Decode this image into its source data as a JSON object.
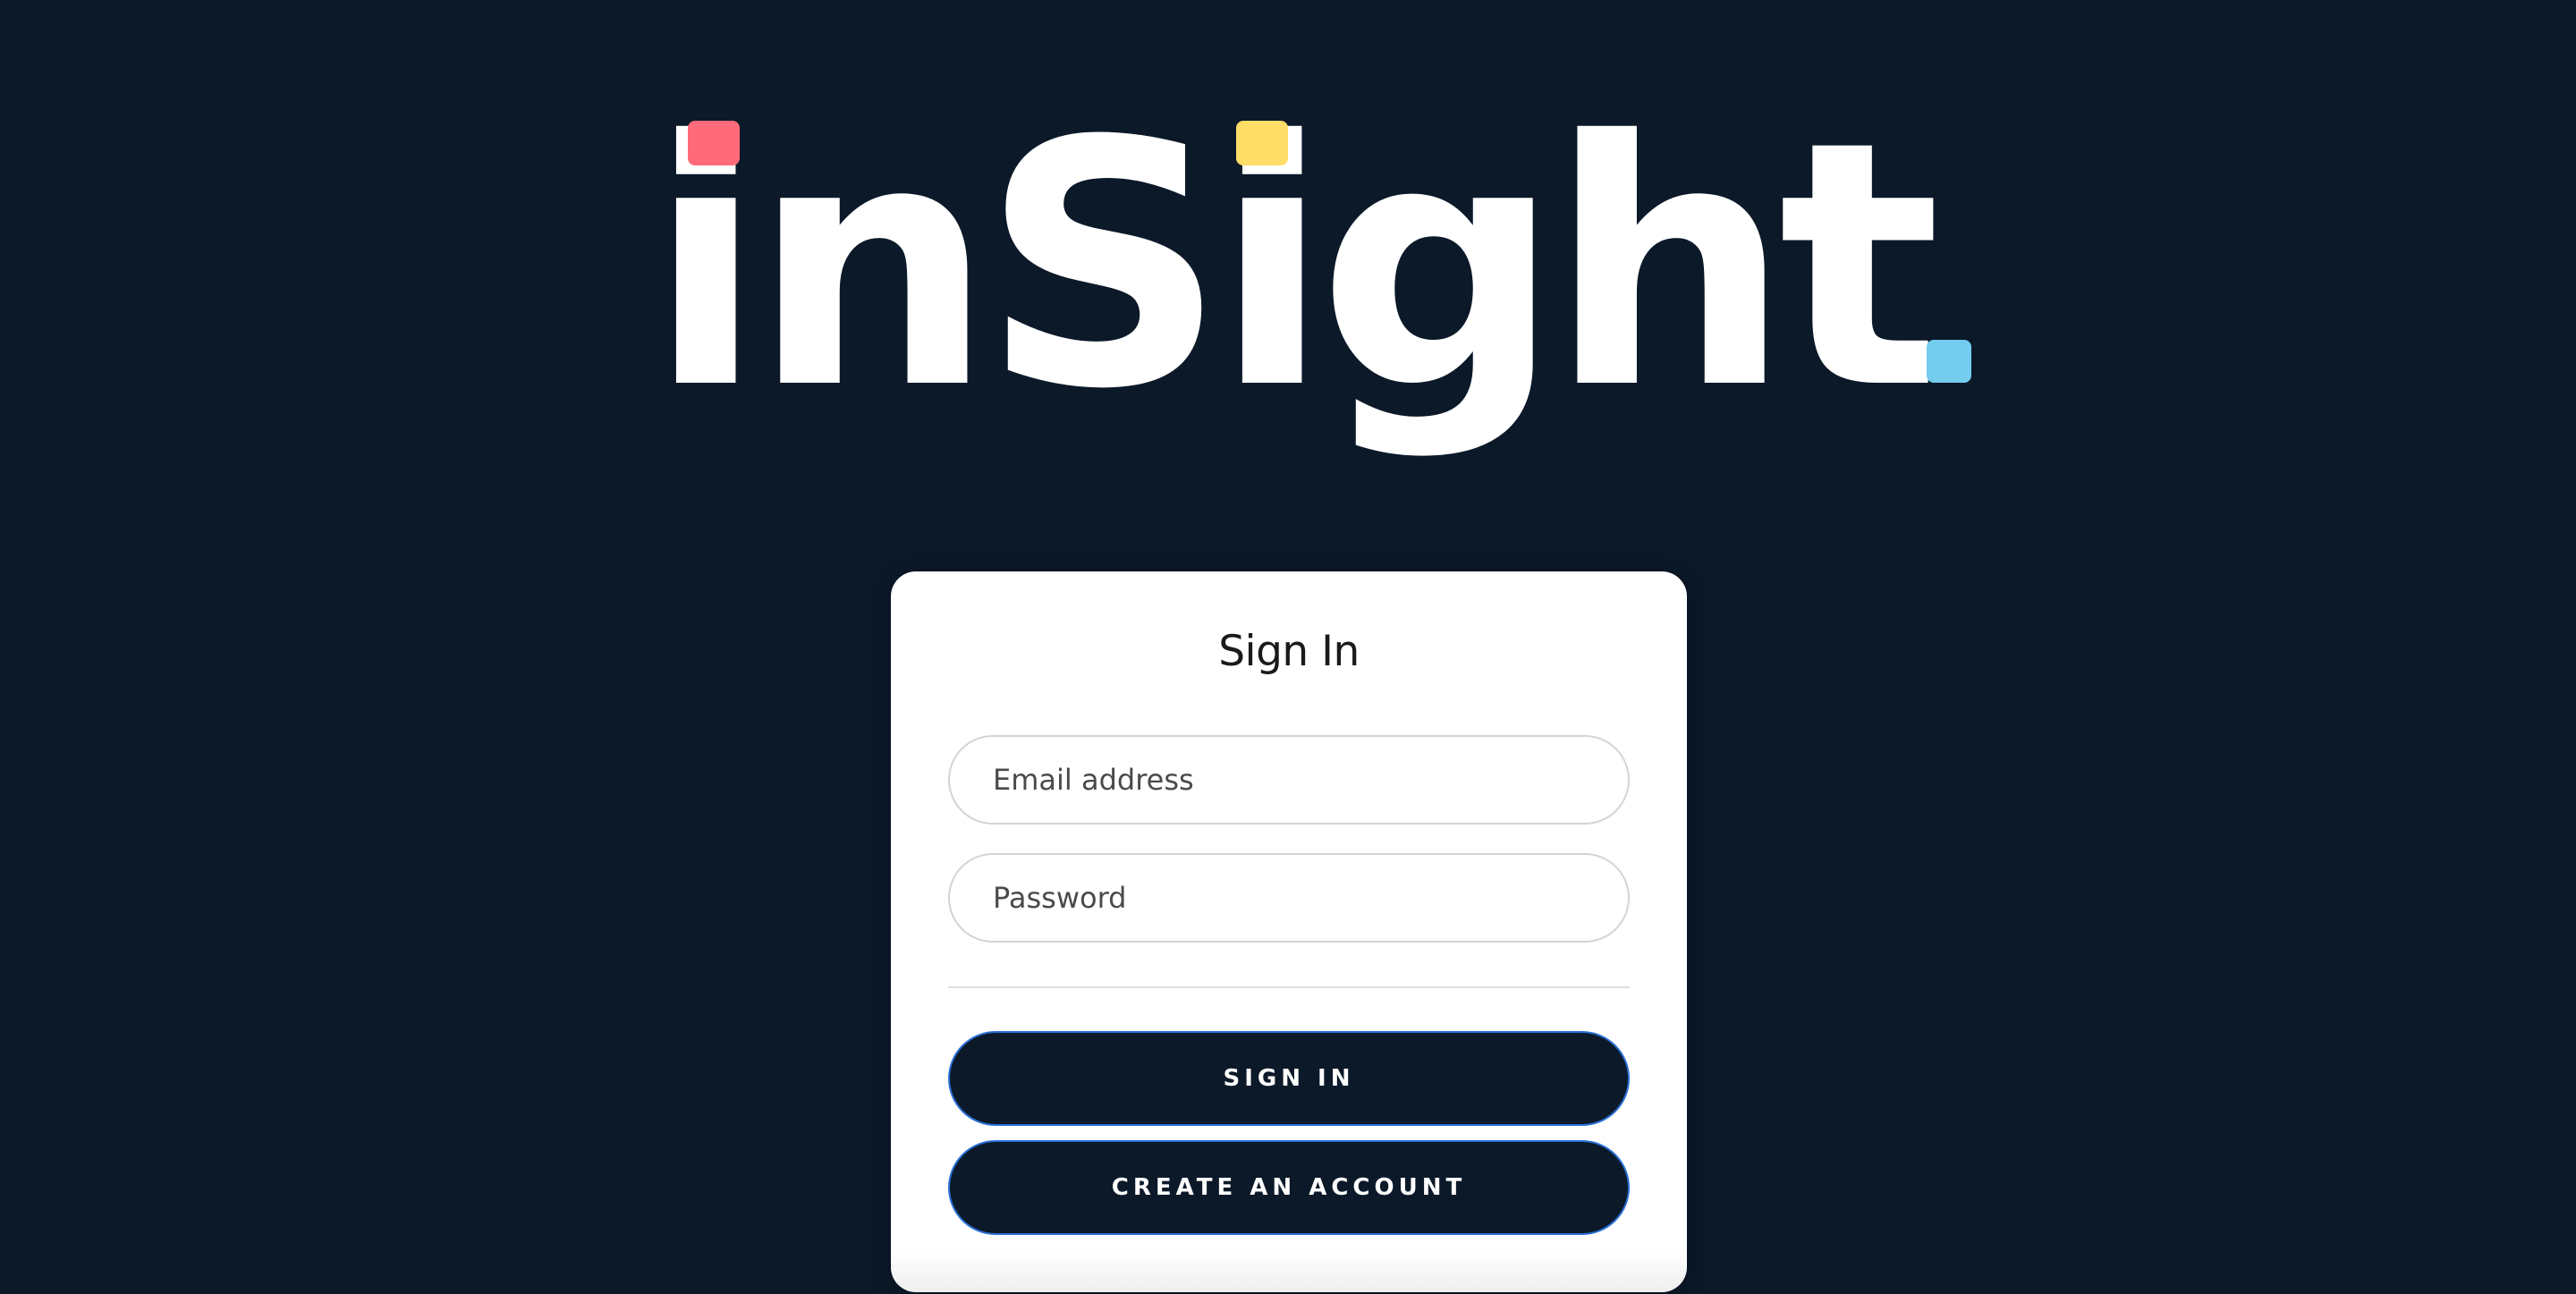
{
  "logo": {
    "text": "inSight",
    "accent_colors": {
      "red": "#ff6b7a",
      "yellow": "#ffdd66",
      "blue": "#74ccef"
    }
  },
  "signin_card": {
    "title": "Sign In",
    "email": {
      "placeholder": "Email address",
      "value": ""
    },
    "password": {
      "placeholder": "Password",
      "value": ""
    },
    "sign_in_label": "SIGN IN",
    "create_account_label": "CREATE AN ACCOUNT"
  },
  "colors": {
    "background": "#0b1929",
    "card": "#ffffff",
    "button": "#0b1929",
    "button_border": "#2a6fd6"
  }
}
